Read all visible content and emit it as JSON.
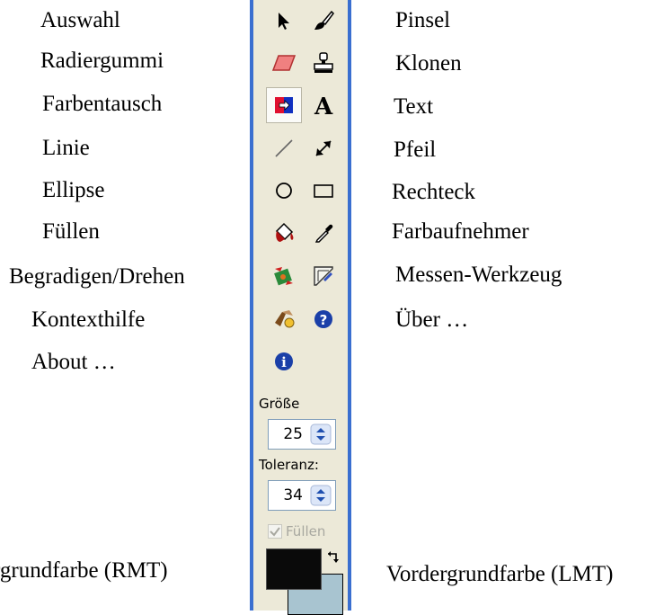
{
  "left_labels": [
    "Auswahl",
    "Radiergummi",
    "Farbentausch",
    "Linie",
    "Ellipse",
    "Füllen",
    "Begradigen/Drehen",
    "Kontexthilfe",
    "About …",
    "rgrundfarbe (RMT)"
  ],
  "right_labels": [
    "Pinsel",
    "Klonen",
    "Text",
    "Pfeil",
    "Rechteck",
    "Farbaufnehmer",
    "Messen-Werkzeug",
    "Über …",
    "Vordergrundfarbe (LMT)"
  ],
  "toolbar": {
    "size_label": "Größe",
    "size_value": "25",
    "tolerance_label": "Toleranz:",
    "tolerance_value": "34",
    "fill_label": "Füllen",
    "foreground_color": "#0a0a0a",
    "background_color": "#a8c4d0",
    "accent_border": "#3a6fd0"
  },
  "icons": [
    "arrow-pointer-icon",
    "brush-icon",
    "eraser-icon",
    "clone-stamp-icon",
    "swap-colors-icon",
    "text-icon",
    "line-icon",
    "arrow-icon",
    "ellipse-icon",
    "rectangle-icon",
    "fill-bucket-icon",
    "color-picker-icon",
    "straighten-rotate-icon",
    "measure-icon",
    "context-help-icon",
    "question-icon",
    "info-icon"
  ]
}
